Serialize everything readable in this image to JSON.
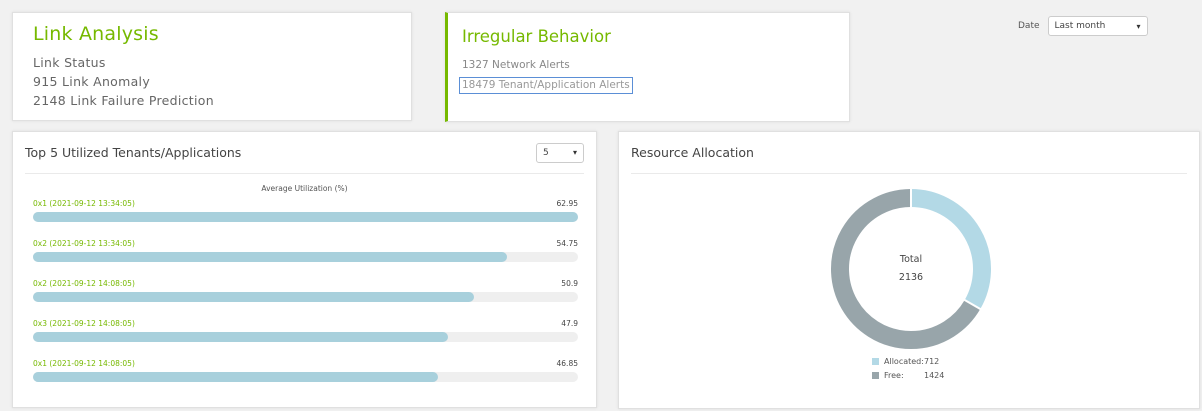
{
  "link_analysis": {
    "title": "Link Analysis",
    "lines": [
      "Link Status",
      "915 Link Anomaly",
      "2148 Link Failure Prediction"
    ]
  },
  "irregular_behavior": {
    "title": "Irregular Behavior",
    "network_alerts": "1327 Network Alerts",
    "tenant_alerts": "18479 Tenant/Application Alerts"
  },
  "date_filter": {
    "label": "Date",
    "value": "Last month"
  },
  "top_tenants": {
    "title": "Top 5 Utilized Tenants/Applications",
    "count_select": "5",
    "subtitle": "Average Utilization (%)",
    "rows": [
      {
        "label": "0x1 (2021-09-12 13:34:05)",
        "value": "62.95",
        "fraction": 1.0
      },
      {
        "label": "0x2 (2021-09-12 13:34:05)",
        "value": "54.75",
        "fraction": 0.87
      },
      {
        "label": "0x2 (2021-09-12 14:08:05)",
        "value": "50.9",
        "fraction": 0.81
      },
      {
        "label": "0x3 (2021-09-12 14:08:05)",
        "value": "47.9",
        "fraction": 0.761
      },
      {
        "label": "0x1 (2021-09-12 14:08:05)",
        "value": "46.85",
        "fraction": 0.744
      }
    ]
  },
  "resource_allocation": {
    "title": "Resource Allocation",
    "total_label": "Total",
    "total_value": "2136",
    "legend": [
      {
        "name": "Allocated:",
        "value": "712",
        "color": "#b3d9e6"
      },
      {
        "name": "Free:",
        "value": "1424",
        "color": "#98a5aa"
      }
    ],
    "chart_data": {
      "type": "pie",
      "labels": [
        "Allocated",
        "Free"
      ],
      "values": [
        712,
        1424
      ]
    }
  },
  "icons": {
    "dropdown": "chevron-down-icon"
  }
}
